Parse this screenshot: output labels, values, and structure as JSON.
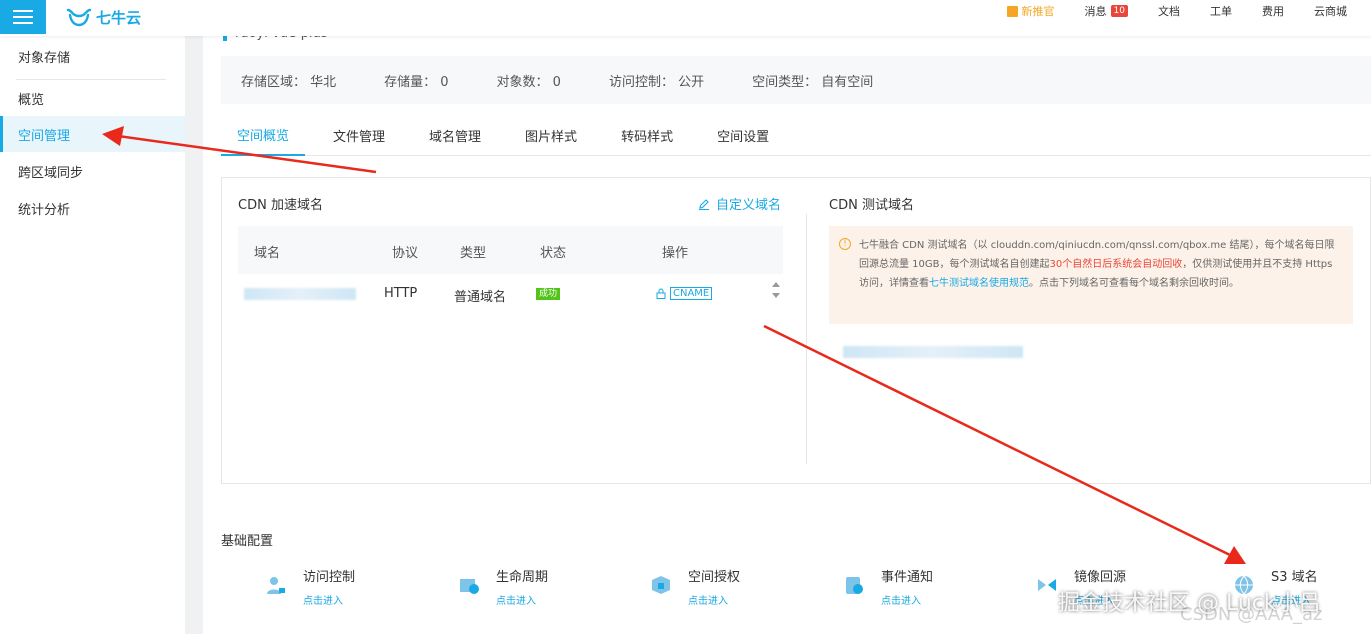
{
  "brand": {
    "logo_text": "七牛云"
  },
  "topnav": {
    "items": [
      "新推官",
      "消息",
      "文档",
      "工单",
      "费用",
      "云商城"
    ],
    "message_count": "10"
  },
  "sidebar": {
    "items": [
      "对象存储",
      "概览",
      "空间管理",
      "跨区域同步",
      "统计分析"
    ]
  },
  "bucket": {
    "name": "ruoyi-vue-plus"
  },
  "info": [
    "存储区域：  华北",
    "存储量：  0",
    "对象数：  0",
    "访问控制：  公开",
    "空间类型：  自有空间"
  ],
  "tabs": [
    "空间概览",
    "文件管理",
    "域名管理",
    "图片样式",
    "转码样式",
    "空间设置"
  ],
  "cdn": {
    "title": "CDN 加速域名",
    "custom_domain": "自定义域名",
    "headers": [
      "域名",
      "协议",
      "类型",
      "状态",
      "操作"
    ],
    "row": {
      "protocol": "HTTP",
      "type": "普通域名",
      "status": "成功",
      "action": "CNAME"
    }
  },
  "test": {
    "title": "CDN 测试域名",
    "notice_1": "七牛融合 CDN 测试域名（以 clouddn.com/qiniucdn.com/qnssl.com/qbox.me 结尾），每个域名每日限回源总流量 10GB，每个测试域名自创建起",
    "notice_red": "30个自然日后系统会自动回收",
    "notice_2": "，仅供测试使用并且不支持 Https 访问，详情查看",
    "notice_link": "七牛测试域名使用规范",
    "notice_3": "。点击下列域名可查看每个域名剩余回收时间。"
  },
  "base": {
    "title": "基础配置",
    "items": [
      {
        "name": "访问控制",
        "enter": "点击进入"
      },
      {
        "name": "生命周期",
        "enter": "点击进入"
      },
      {
        "name": "空间授权",
        "enter": "点击进入"
      },
      {
        "name": "事件通知",
        "enter": "点击进入"
      },
      {
        "name": "镜像回源",
        "enter": "点击进入"
      },
      {
        "name": "S3 域名",
        "enter": "点击进入"
      }
    ]
  },
  "watermark": {
    "text": "掘金技术社区 @ Luck小吕",
    "text2": "CSDN @AAA_az"
  },
  "colors": {
    "accent": "#19a9e5",
    "success": "#52c41a",
    "danger": "#e8463a",
    "arrow": "#e8291c"
  }
}
